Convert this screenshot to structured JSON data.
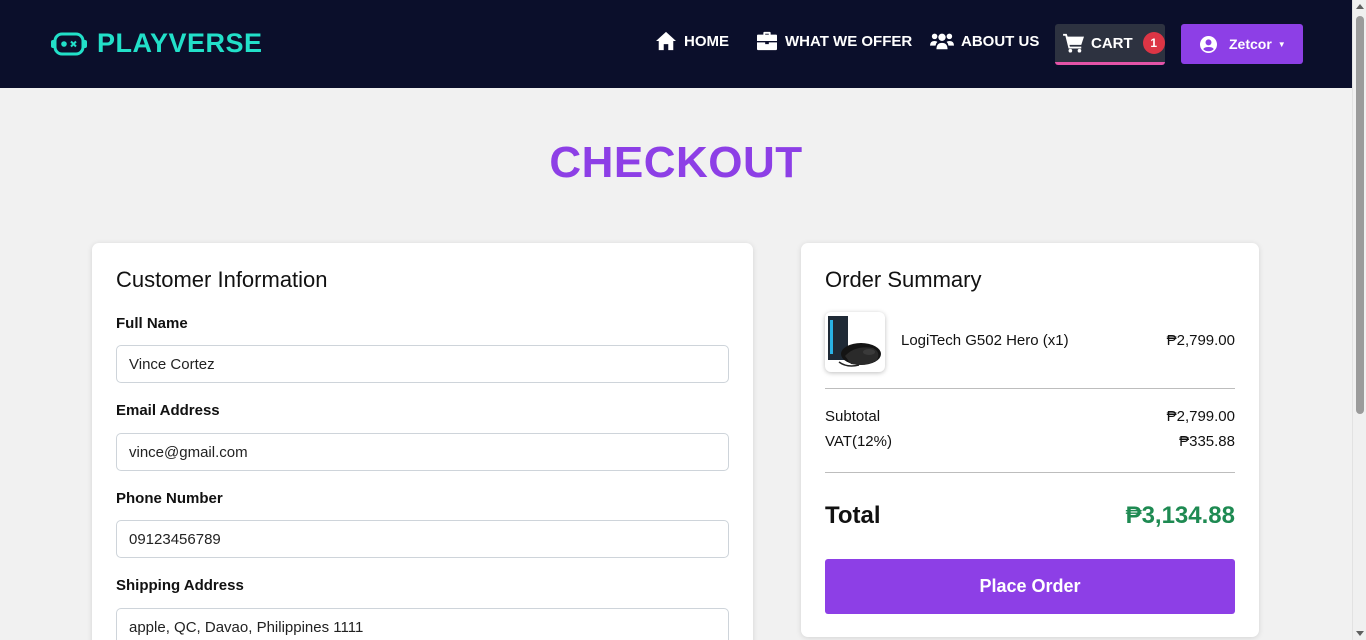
{
  "nav": {
    "brand": "PLAYVERSE",
    "links": [
      {
        "label": "HOME",
        "icon": "home-icon"
      },
      {
        "label": "WHAT WE OFFER",
        "icon": "briefcase-icon"
      },
      {
        "label": "ABOUT US",
        "icon": "users-icon"
      }
    ],
    "cart": {
      "label": "CART",
      "count": "1",
      "icon": "cart-icon"
    },
    "user": {
      "label": "Zetcor",
      "icon": "user-circle-icon"
    }
  },
  "page": {
    "title": "CHECKOUT"
  },
  "customer": {
    "title": "Customer Information",
    "fields": [
      {
        "label": "Full Name",
        "value": "Vince Cortez"
      },
      {
        "label": "Email Address",
        "value": "vince@gmail.com"
      },
      {
        "label": "Phone Number",
        "value": "09123456789"
      },
      {
        "label": "Shipping Address",
        "value": "apple, QC, Davao, Philippines 1111"
      }
    ]
  },
  "summary": {
    "title": "Order Summary",
    "item": {
      "name": "LogiTech G502 Hero (x1)",
      "price": "₱2,799.00"
    },
    "subtotal_label": "Subtotal",
    "subtotal_value": "₱2,799.00",
    "vat_label": "VAT(12%)",
    "vat_value": "₱335.88",
    "total_label": "Total",
    "total_value": "₱3,134.88",
    "place_order": "Place Order"
  },
  "colors": {
    "navbar": "#0b0f2b",
    "brand": "#22e0c9",
    "accent": "#8d3fe6",
    "total": "#1e8a52",
    "badge": "#dc3545",
    "cart_underline": "#e453a8"
  }
}
